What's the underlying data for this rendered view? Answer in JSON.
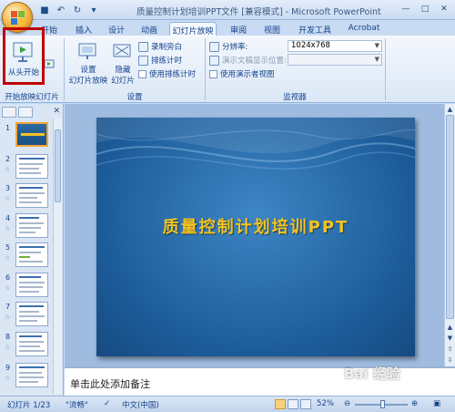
{
  "window": {
    "title": "质量控制计划培训PPT文件 [兼容模式] - Microsoft PowerPoint",
    "controls": [
      "—",
      "□",
      "✕"
    ]
  },
  "quick_access": {
    "icons": [
      "save-icon",
      "undo-icon",
      "redo-icon",
      "dropdown-icon"
    ]
  },
  "ribbon_tabs": [
    "开始",
    "插入",
    "设计",
    "动画",
    "幻灯片放映",
    "审阅",
    "视图",
    "开发工具",
    "Acrobat"
  ],
  "active_tab": "幻灯片放映",
  "ribbon": {
    "group1": {
      "label": "开始放映幻灯片",
      "start_btn": "从头开始"
    },
    "group2": {
      "label": "设置",
      "setup_btn_line1": "设置",
      "setup_btn_line2": "幻灯片放映",
      "hide_btn_line1": "隐藏",
      "hide_btn_line2": "幻灯片",
      "record": "录制旁白",
      "rehearse": "排练计时",
      "use_timings": "使用排练计时"
    },
    "group3": {
      "label": "监视器",
      "resolution_label": "分辨率:",
      "resolution_value": "1024x768",
      "show_on_label": "演示文稿显示位置:",
      "presenter_view": "使用演示者视图"
    }
  },
  "thumbnails": [
    "1",
    "2",
    "3",
    "4",
    "5",
    "6",
    "7",
    "8",
    "9"
  ],
  "slide": {
    "title": "质量控制计划培训PPT"
  },
  "notes": {
    "placeholder": "单击此处添加备注"
  },
  "statusbar": {
    "slide_info": "幻灯片 1/23",
    "theme": "\"流畅\"",
    "language": "中文(中国)",
    "zoom": "52%",
    "zoom_level": 0.52
  },
  "watermark": "Bai 经验",
  "colors": {
    "accent": "#c00000",
    "slide_title": "#f3c321",
    "slide_bg": "#1c5b99"
  }
}
